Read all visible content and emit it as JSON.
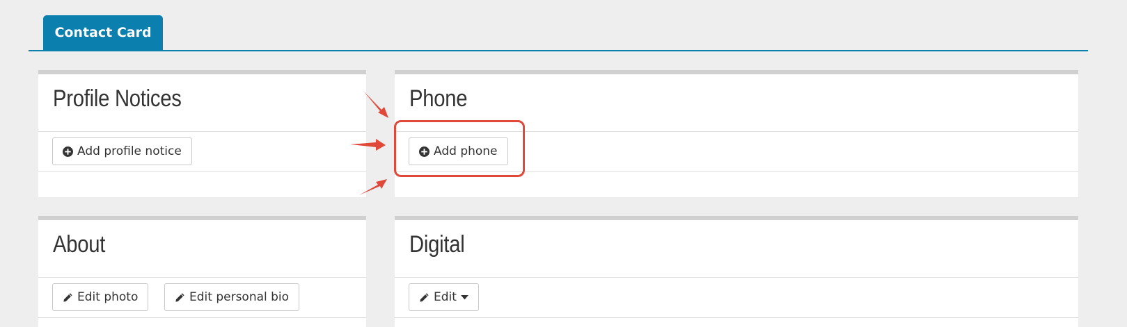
{
  "tabs": [
    {
      "label": "Contact Card",
      "active": true
    }
  ],
  "cards": {
    "profile_notices": {
      "title": "Profile Notices",
      "add_button": "Add profile notice"
    },
    "phone": {
      "title": "Phone",
      "add_button": "Add phone"
    },
    "about": {
      "title": "About",
      "edit_photo": "Edit photo",
      "edit_bio": "Edit personal bio"
    },
    "digital": {
      "title": "Digital",
      "edit_button": "Edit"
    }
  },
  "icons": {
    "add": "plus-circle-icon",
    "edit": "pencil-icon",
    "dropdown": "caret-down-icon"
  },
  "colors": {
    "tab_accent": "#0b7fae",
    "annotation": "#e0493a",
    "card_top_border": "#d0d0d0",
    "page_background": "#eeeeee"
  }
}
